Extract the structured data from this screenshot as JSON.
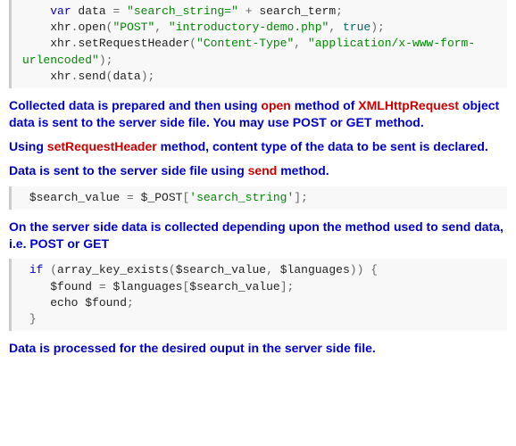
{
  "code1": {
    "l1": {
      "a": "    ",
      "kw": "var",
      "b": " data ",
      "op1": "=",
      "c": " ",
      "s": "\"search_string=\"",
      "d": " ",
      "op2": "+",
      "e": " search_term",
      "p": ";"
    },
    "l2": {
      "a": "    xhr",
      "op": ".",
      "m": "open",
      "lp": "(",
      "s1": "\"POST\"",
      "c1": ",",
      "sp1": " ",
      "s2": "\"introductory-demo.php\"",
      "c2": ",",
      "sp2": " ",
      "b": "true",
      "rp": ")",
      "p": ";"
    },
    "l3": {
      "a": "    xhr",
      "op": ".",
      "m": "setRequestHeader",
      "lp": "(",
      "s1": "\"Content-Type\"",
      "c1": ",",
      "sp": " ",
      "s2": "\"application/x-www-form-urlencoded\"",
      "rp": ")",
      "p": ";"
    },
    "l4": {
      "a": "    xhr",
      "op": ".",
      "m": "send",
      "lp": "(",
      "v": "data",
      "rp": ")",
      "p": ";"
    }
  },
  "p1": {
    "a": "Collected data is prepared and then using ",
    "r1": "open",
    "b": " method of ",
    "r2": "XMLHttpRequest",
    "c": " object data is sent to the server side file. You may use POST or GET method."
  },
  "p2": {
    "a": "Using ",
    "r": "setRequestHeader",
    "b": " method, content type of the data to be sent is declared."
  },
  "p3": {
    "a": "Data is sent to the server side file using ",
    "r": "send",
    "b": " method."
  },
  "code2": {
    "a": " $search_value ",
    "op": "=",
    "b": " $_POST",
    "lb": "[",
    "s": "'search_string'",
    "rb": "]",
    "p": ";"
  },
  "p4": {
    "a": "On the server side data is collected depending upon the method used to send data, i.e. POST or GET"
  },
  "code3": {
    "l1": {
      "a": " ",
      "kw": "if",
      "sp": " ",
      "lp": "(",
      "fn": "array_key_exists",
      "lp2": "(",
      "v1": "$search_value",
      "c": ",",
      "sp2": " ",
      "v2": "$languages",
      "rp2": ")",
      "rp": ")",
      "sp3": " ",
      "lb": "{"
    },
    "l2": {
      "a": "    $found ",
      "op": "=",
      "b": " $languages",
      "lb": "[",
      "v": "$search_value",
      "rb": "]",
      "p": ";"
    },
    "l3": {
      "a": "    echo $found",
      "p": ";"
    },
    "l4": {
      "rb": " }"
    }
  },
  "p5": {
    "a": "Data is processed for the desired ouput in the server side file."
  }
}
